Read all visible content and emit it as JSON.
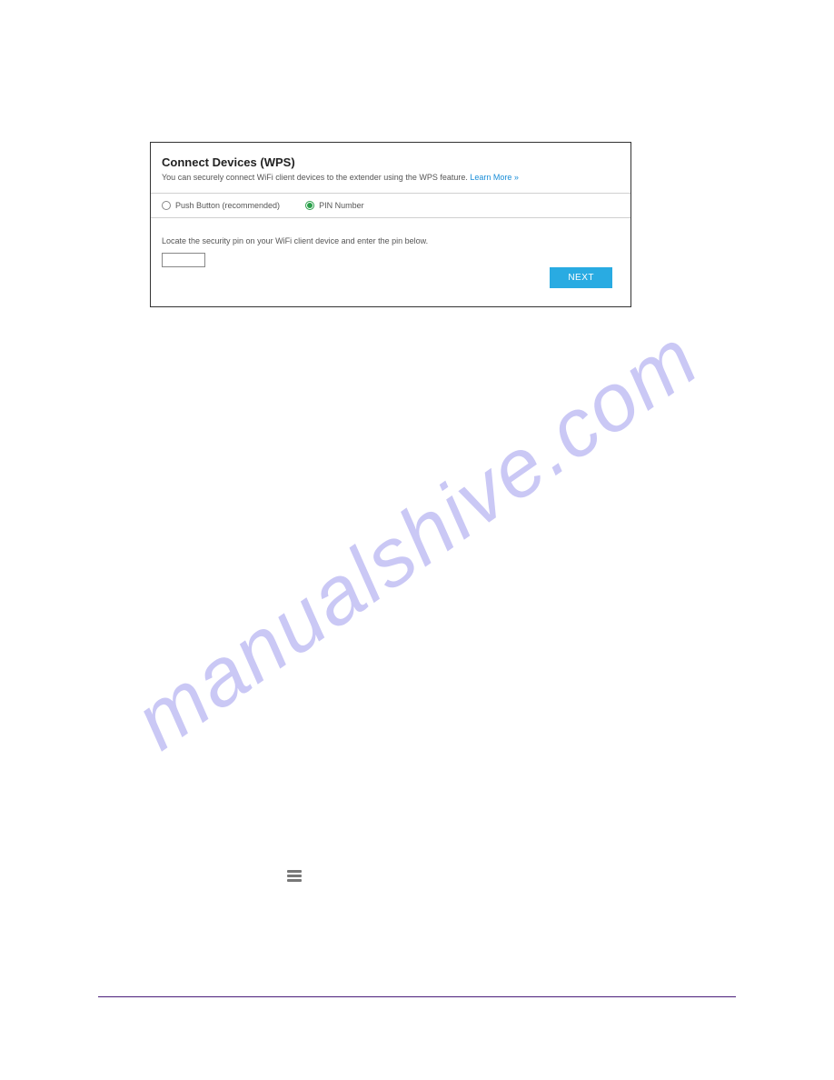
{
  "watermark": "manualshive.com",
  "panel": {
    "title": "Connect Devices (WPS)",
    "subtitle_text": "You can securely connect WiFi client devices to the extender using the WPS feature. ",
    "learn_more": "Learn More »",
    "option_push": "Push Button (recommended)",
    "option_pin": "PIN Number",
    "pin_instruction": "Locate the security pin on your WiFi client device and enter the pin below.",
    "pin_value": "",
    "next_label": "NEXT"
  }
}
